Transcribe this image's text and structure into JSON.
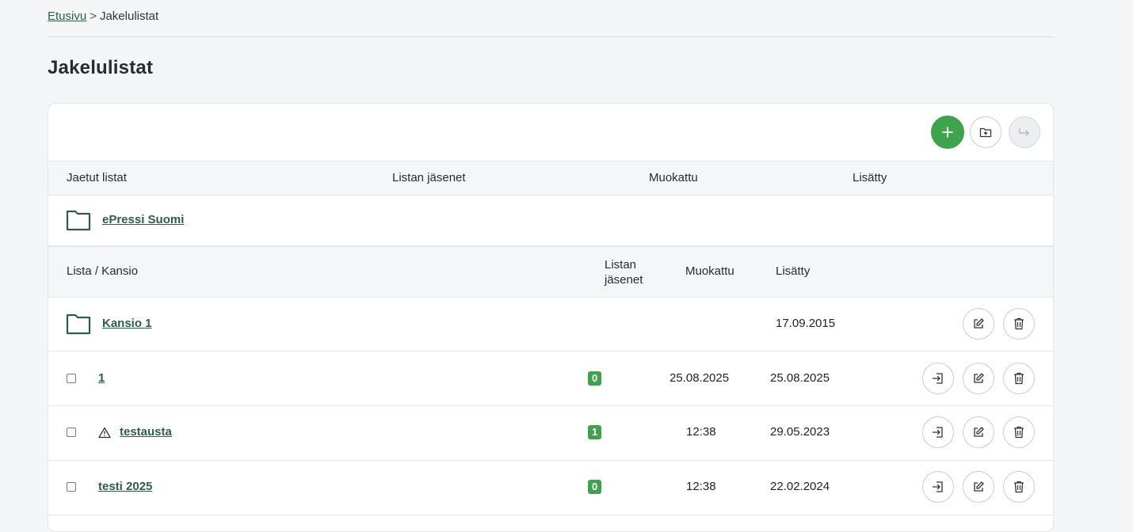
{
  "breadcrumb": {
    "home": "Etusivu",
    "separator": ">",
    "current": "Jakelulistat"
  },
  "page_title": "Jakelulistat",
  "toolbar": {
    "add_icon": "plus-icon",
    "new_folder_icon": "folder-plus-icon",
    "move_icon": "move-arrow-icon"
  },
  "shared_header": {
    "col1": "Jaetut listat",
    "col2": "Listan jäsenet",
    "col3": "Muokattu",
    "col4": "Lisätty"
  },
  "shared_folder": {
    "name": "ePressi Suomi"
  },
  "list_header": {
    "col1": "Lista / Kansio",
    "col2_line1": "Listan",
    "col2_line2": "jäsenet",
    "col3": "Muokattu",
    "col4": "Lisätty"
  },
  "folder_row": {
    "name": "Kansio 1",
    "added": "17.09.2015"
  },
  "rows": [
    {
      "name": "1",
      "members": "0",
      "modified": "25.08.2025",
      "added": "25.08.2025",
      "warning": false
    },
    {
      "name": "testausta",
      "members": "1",
      "modified": "12:38",
      "added": "29.05.2023",
      "warning": true
    },
    {
      "name": "testi 2025",
      "members": "0",
      "modified": "12:38",
      "added": "22.02.2024",
      "warning": false
    }
  ],
  "colors": {
    "accent": "#3fa34d",
    "link": "#2f5d46"
  }
}
